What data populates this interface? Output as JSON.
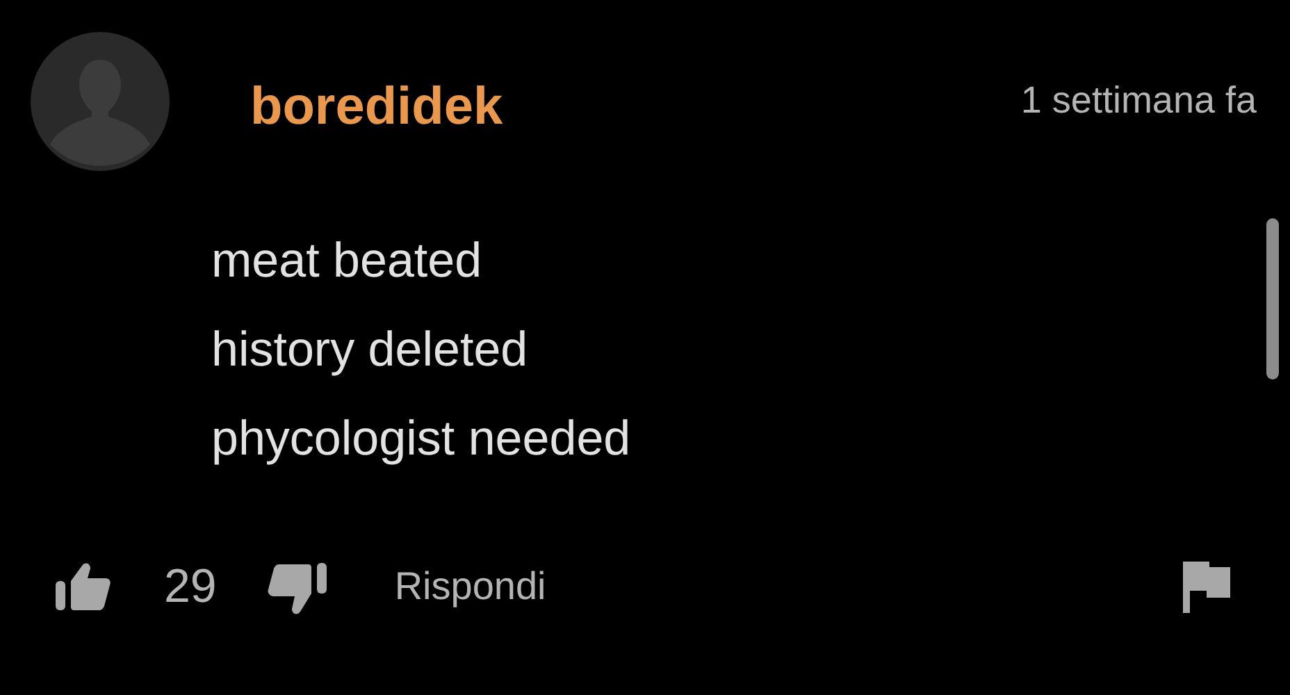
{
  "comment": {
    "username": "boredidek",
    "time": "1 settimana fa",
    "lines": [
      "meat beated",
      "history deleted",
      "phycologist needed"
    ],
    "likes": "29",
    "reply": "Rispondi"
  }
}
